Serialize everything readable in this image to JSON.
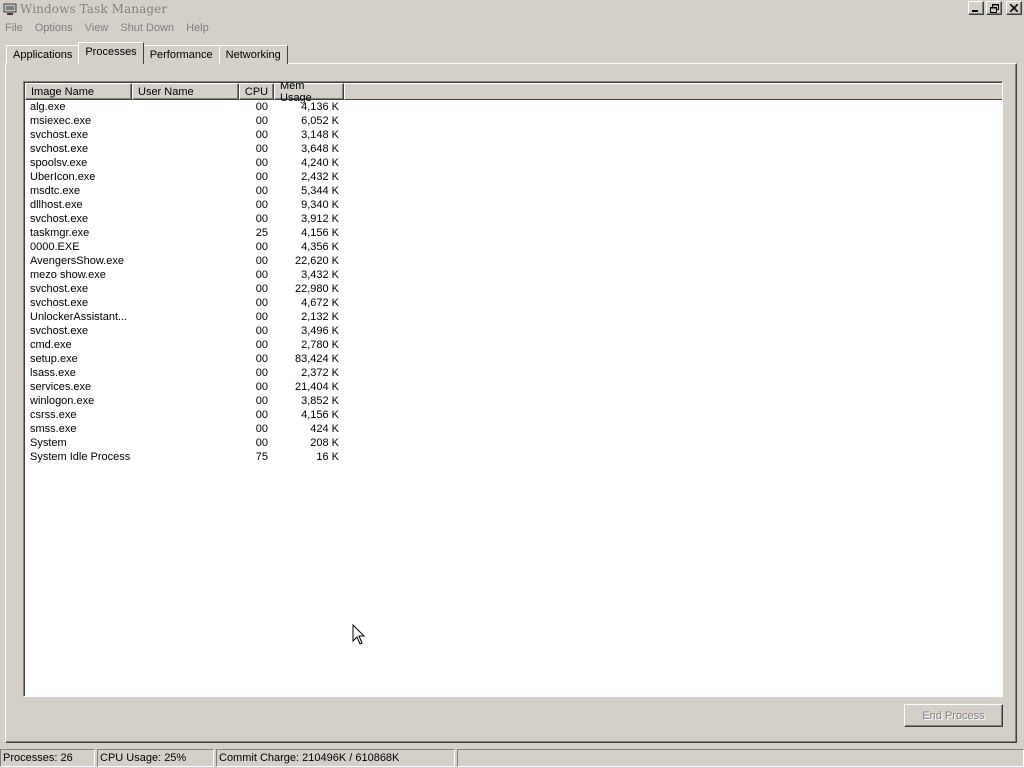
{
  "window": {
    "title": "Windows Task Manager"
  },
  "menu": [
    "File",
    "Options",
    "View",
    "Shut Down",
    "Help"
  ],
  "tabs": [
    {
      "label": "Applications",
      "active": false
    },
    {
      "label": "Processes",
      "active": true
    },
    {
      "label": "Performance",
      "active": false
    },
    {
      "label": "Networking",
      "active": false
    }
  ],
  "columns": {
    "image": "Image Name",
    "user": "User Name",
    "cpu": "CPU",
    "mem": "Mem Usage"
  },
  "processes": [
    {
      "image": "alg.exe",
      "user": "",
      "cpu": "00",
      "mem": "4,136 K"
    },
    {
      "image": "msiexec.exe",
      "user": "",
      "cpu": "00",
      "mem": "6,052 K"
    },
    {
      "image": "svchost.exe",
      "user": "",
      "cpu": "00",
      "mem": "3,148 K"
    },
    {
      "image": "svchost.exe",
      "user": "",
      "cpu": "00",
      "mem": "3,648 K"
    },
    {
      "image": "spoolsv.exe",
      "user": "",
      "cpu": "00",
      "mem": "4,240 K"
    },
    {
      "image": "UberIcon.exe",
      "user": "",
      "cpu": "00",
      "mem": "2,432 K"
    },
    {
      "image": "msdtc.exe",
      "user": "",
      "cpu": "00",
      "mem": "5,344 K"
    },
    {
      "image": "dllhost.exe",
      "user": "",
      "cpu": "00",
      "mem": "9,340 K"
    },
    {
      "image": "svchost.exe",
      "user": "",
      "cpu": "00",
      "mem": "3,912 K"
    },
    {
      "image": "taskmgr.exe",
      "user": "",
      "cpu": "25",
      "mem": "4,156 K"
    },
    {
      "image": "0000.EXE",
      "user": "",
      "cpu": "00",
      "mem": "4,356 K"
    },
    {
      "image": "AvengersShow.exe",
      "user": "",
      "cpu": "00",
      "mem": "22,620 K"
    },
    {
      "image": "mezo show.exe",
      "user": "",
      "cpu": "00",
      "mem": "3,432 K"
    },
    {
      "image": "svchost.exe",
      "user": "",
      "cpu": "00",
      "mem": "22,980 K"
    },
    {
      "image": "svchost.exe",
      "user": "",
      "cpu": "00",
      "mem": "4,672 K"
    },
    {
      "image": "UnlockerAssistant...",
      "user": "",
      "cpu": "00",
      "mem": "2,132 K"
    },
    {
      "image": "svchost.exe",
      "user": "",
      "cpu": "00",
      "mem": "3,496 K"
    },
    {
      "image": "cmd.exe",
      "user": "",
      "cpu": "00",
      "mem": "2,780 K"
    },
    {
      "image": "setup.exe",
      "user": "",
      "cpu": "00",
      "mem": "83,424 K"
    },
    {
      "image": "lsass.exe",
      "user": "",
      "cpu": "00",
      "mem": "2,372 K"
    },
    {
      "image": "services.exe",
      "user": "",
      "cpu": "00",
      "mem": "21,404 K"
    },
    {
      "image": "winlogon.exe",
      "user": "",
      "cpu": "00",
      "mem": "3,852 K"
    },
    {
      "image": "csrss.exe",
      "user": "",
      "cpu": "00",
      "mem": "4,156 K"
    },
    {
      "image": "smss.exe",
      "user": "",
      "cpu": "00",
      "mem": "424 K"
    },
    {
      "image": "System",
      "user": "",
      "cpu": "00",
      "mem": "208 K"
    },
    {
      "image": "System Idle Process",
      "user": "",
      "cpu": "75",
      "mem": "16 K"
    }
  ],
  "end_process_label": "End Process",
  "status": {
    "processes": "Processes: 26",
    "cpu": "CPU Usage: 25%",
    "commit": "Commit Charge: 210496K / 610868K"
  },
  "icons": {
    "app": "task-manager-icon",
    "minimize": "minimize-icon",
    "restore": "restore-icon",
    "close": "close-icon",
    "cursor": "mouse-pointer-icon"
  }
}
